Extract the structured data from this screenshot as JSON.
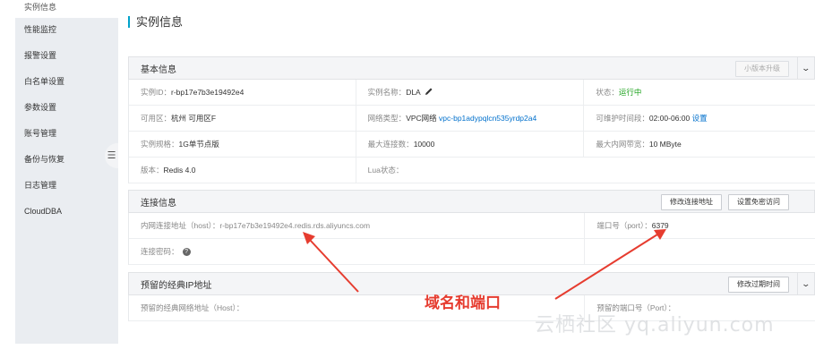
{
  "sidebar": {
    "items": [
      {
        "label": "实例信息"
      },
      {
        "label": "性能监控"
      },
      {
        "label": "报警设置"
      },
      {
        "label": "白名单设置"
      },
      {
        "label": "参数设置"
      },
      {
        "label": "账号管理"
      },
      {
        "label": "备份与恢复"
      },
      {
        "label": "日志管理"
      },
      {
        "label": "CloudDBA"
      }
    ]
  },
  "page": {
    "title": "实例信息"
  },
  "basic": {
    "title": "基本信息",
    "upgrade_button": "小版本升级",
    "instance_id_label": "实例ID：",
    "instance_id": "r-bp17e7b3e19492e4",
    "instance_name_label": "实例名称：",
    "instance_name": "DLA",
    "status_label": "状态：",
    "status": "运行中",
    "zone_label": "可用区：",
    "zone": "杭州 可用区F",
    "network_label": "网络类型：",
    "network_type": "VPC网络",
    "vpc_id": "vpc-bp1adypqlcn535yrdp2a4",
    "maintenance_label": "可维护时间段：",
    "maintenance_window": "02:00-06:00",
    "maintenance_set": "设置",
    "spec_label": "实例规格：",
    "spec": "1G单节点版",
    "max_conn_label": "最大连接数：",
    "max_conn": "10000",
    "bandwidth_label": "最大内网带宽：",
    "bandwidth": "10 MByte",
    "version_label": "版本：",
    "version": "Redis 4.0",
    "lua_label": "Lua状态："
  },
  "connection": {
    "title": "连接信息",
    "modify_button": "修改连接地址",
    "passwordless_button": "设置免密访问",
    "host_label": "内网连接地址（host）：",
    "host": "r-bp17e7b3e19492e4.redis.rds.aliyuncs.com",
    "port_label": "端口号（port）：",
    "port": "6379",
    "password_label": "连接密码："
  },
  "classic": {
    "title": "预留的经典IP地址",
    "expire_button": "修改过期时间",
    "host_label": "预留的经典网络地址（Host）：",
    "port_label": "预留的端口号（Port）："
  },
  "annotation": {
    "text": "域名和端口",
    "color": "#e63c2f"
  },
  "watermark": "云栖社区 yq.aliyun.com",
  "colors": {
    "accent": "#00a2ca",
    "link": "#0070cc",
    "status_ok": "#1aa11a"
  }
}
